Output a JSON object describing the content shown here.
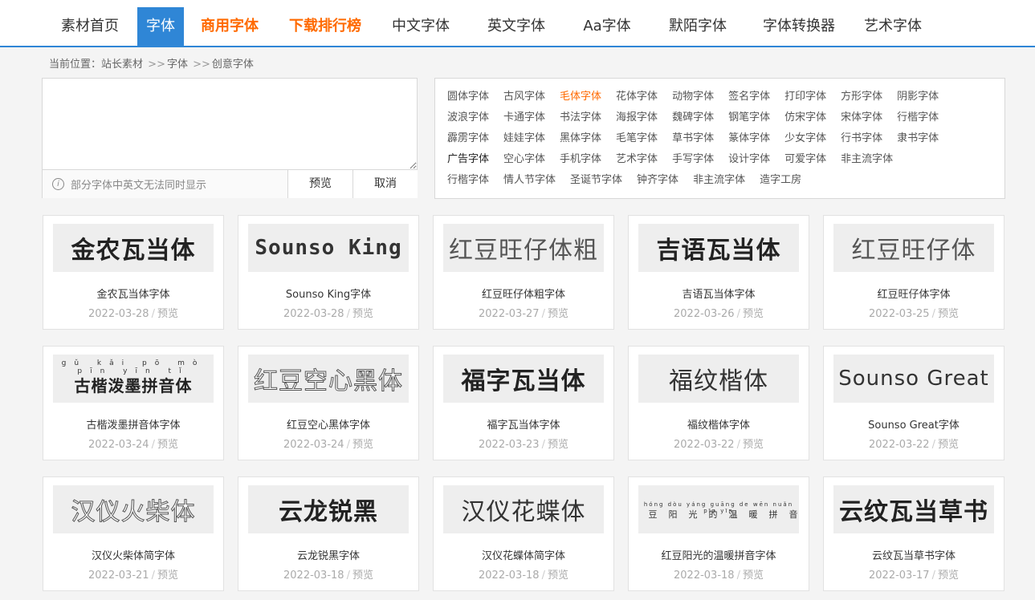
{
  "nav": [
    {
      "label": "素材首页",
      "state": "normal",
      "width": 118
    },
    {
      "label": "字体",
      "state": "active",
      "width": 58
    },
    {
      "label": "商用字体",
      "state": "hot",
      "width": 114
    },
    {
      "label": "下载排行榜",
      "state": "hot",
      "width": 124
    },
    {
      "label": "中文字体",
      "state": "normal",
      "width": 114
    },
    {
      "label": "英文字体",
      "state": "normal",
      "width": 124
    },
    {
      "label": "Aa字体",
      "state": "normal",
      "width": 102
    },
    {
      "label": "默陌字体",
      "state": "normal",
      "width": 124
    },
    {
      "label": "字体转换器",
      "state": "normal",
      "width": 128
    },
    {
      "label": "艺术字体",
      "state": "normal",
      "width": 106
    }
  ],
  "breadcrumb": {
    "prefix": "当前位置：",
    "items": [
      "站长素材",
      "字体",
      "创意字体"
    ],
    "sep": ">>"
  },
  "search": {
    "hint": "部分字体中英文无法同时显示",
    "preview_label": "预览",
    "cancel_label": "取消"
  },
  "tags": [
    [
      "圆体字体",
      "古风字体",
      "毛体字体",
      "花体字体",
      "动物字体",
      "签名字体",
      "打印字体",
      "方形字体",
      "阴影字体"
    ],
    [
      "波浪字体",
      "卡通字体",
      "书法字体",
      "海报字体",
      "魏碑字体",
      "钢笔字体",
      "仿宋字体",
      "宋体字体",
      "行楷字体"
    ],
    [
      "霹雳字体",
      "娃娃字体",
      "黑体字体",
      "毛笔字体",
      "草书字体",
      "篆体字体",
      "少女字体",
      "行书字体",
      "隶书字体"
    ],
    [
      "广告字体",
      "空心字体",
      "手机字体",
      "艺术字体",
      "手写字体",
      "设计字体",
      "可爱字体",
      "非主流字体"
    ],
    [
      "行楷字体",
      "情人节字体",
      "圣诞节字体",
      "钟齐字体",
      "非主流字体",
      "造字工房"
    ]
  ],
  "highlight_tag": "毛体字体",
  "dark_tag": "广告字体",
  "cards": [
    {
      "preview": "金农瓦当体",
      "style": "bold",
      "name": "金农瓦当体字体",
      "date": "2022-03-28",
      "action": "预览"
    },
    {
      "preview": "Sounso King",
      "style": "en",
      "name": "Sounso King字体",
      "date": "2022-03-28",
      "action": "预览"
    },
    {
      "preview": "红豆旺仔体粗",
      "style": "thin",
      "name": "红豆旺仔体粗字体",
      "date": "2022-03-27",
      "action": "预览"
    },
    {
      "preview": "吉语瓦当体",
      "style": "bold",
      "name": "吉语瓦当体字体",
      "date": "2022-03-26",
      "action": "预览"
    },
    {
      "preview": "红豆旺仔体",
      "style": "thin",
      "name": "红豆旺仔体字体",
      "date": "2022-03-25",
      "action": "预览"
    },
    {
      "preview": "古楷泼墨拼音体",
      "style": "pinyin",
      "pinyin": "gǔ kǎi pō mò pīn yīn tǐ",
      "name": "古楷泼墨拼音体字体",
      "date": "2022-03-24",
      "action": "预览"
    },
    {
      "preview": "红豆空心黑体",
      "style": "outline",
      "name": "红豆空心黑体字体",
      "date": "2022-03-24",
      "action": "预览"
    },
    {
      "preview": "福字瓦当体",
      "style": "bold",
      "name": "福字瓦当体字体",
      "date": "2022-03-23",
      "action": "预览"
    },
    {
      "preview": "福纹楷体",
      "style": "normal",
      "name": "福纹楷体字体",
      "date": "2022-03-22",
      "action": "预览"
    },
    {
      "preview": "Sounso Great",
      "style": "en2",
      "name": "Sounso Great字体",
      "date": "2022-03-22",
      "action": "预览"
    },
    {
      "preview": "汉仪火柴体",
      "style": "outline",
      "name": "汉仪火柴体简字体",
      "date": "2022-03-21",
      "action": "预览"
    },
    {
      "preview": "云龙锐黑",
      "style": "bold",
      "name": "云龙锐黑字体",
      "date": "2022-03-18",
      "action": "预览"
    },
    {
      "preview": "汉仪花蝶体",
      "style": "normal",
      "name": "汉仪花蝶体简字体",
      "date": "2022-03-18",
      "action": "预览"
    },
    {
      "preview": "红豆阳光的温暖拼音",
      "style": "pinyinsmall",
      "pinyin": "hóng dòu yáng guāng de wēn nuǎn pīn yīn",
      "name": "红豆阳光的温暖拼音字体",
      "date": "2022-03-18",
      "action": "预览"
    },
    {
      "preview": "云纹瓦当草书",
      "style": "bold",
      "name": "云纹瓦当草书字体",
      "date": "2022-03-17",
      "action": "预览"
    }
  ]
}
